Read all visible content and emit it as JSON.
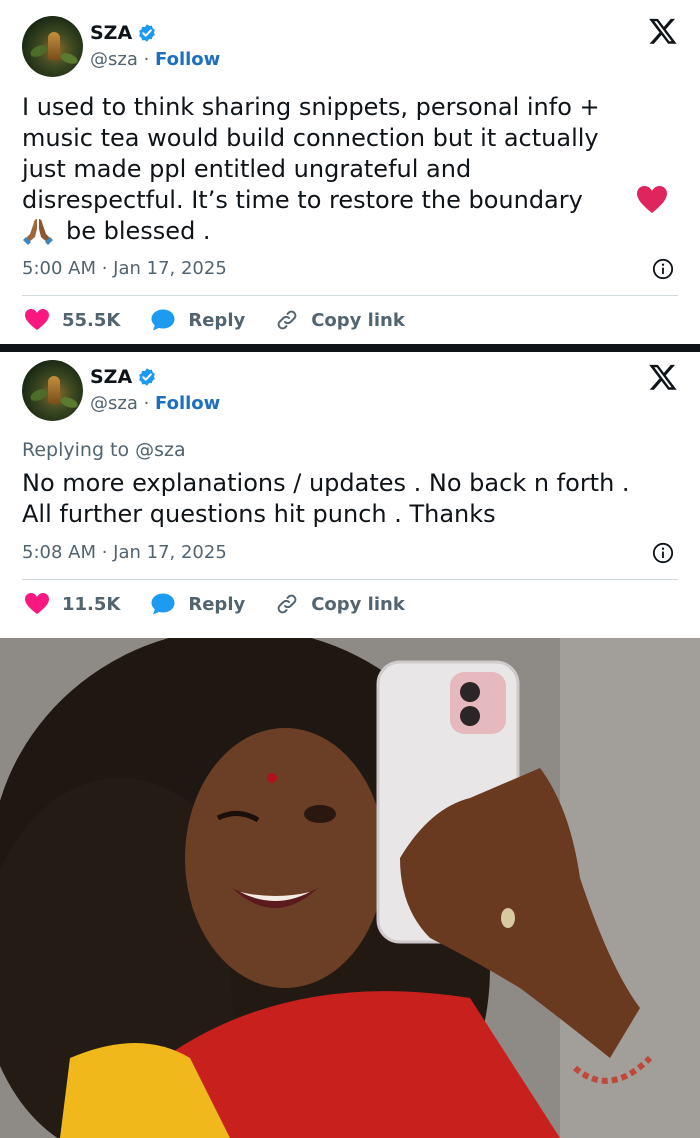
{
  "tweets": [
    {
      "name": "SZA",
      "handle": "@sza",
      "separator": " · ",
      "follow_label": "Follow",
      "replying_to": "",
      "text_lines": [
        "I used to think sharing snippets, personal info +",
        "music tea would build connection but it actually",
        "just made ppl entitled ungrateful and",
        "disrespectful. It’s time to restore the boundary"
      ],
      "text_last": "be blessed .",
      "timestamp": "5:00 AM · Jan 17, 2025",
      "likes": "55.5K",
      "reply_label": "Reply",
      "copy_label": "Copy link"
    },
    {
      "name": "SZA",
      "handle": "@sza",
      "separator": " · ",
      "follow_label": "Follow",
      "replying_to": "Replying to @sza",
      "text_lines": [
        "No more explanations / updates . No back n forth .",
        "All further questions hit punch . Thanks"
      ],
      "timestamp": "5:08 AM · Jan 17, 2025",
      "likes": "11.5K",
      "reply_label": "Reply",
      "copy_label": "Copy link"
    }
  ],
  "icons": {
    "verified": "verified-badge-icon",
    "x_logo": "x-logo-icon",
    "info": "info-icon",
    "like": "heart-icon",
    "reply": "reply-bubble-icon",
    "copy": "link-icon",
    "emoji_heart": "red-heart-emoji",
    "emoji_pray": "folded-hands-emoji"
  },
  "colors": {
    "like": "#f91880",
    "reply": "#1d9bf0",
    "follow": "#1d6fbf",
    "muted": "#536471",
    "text": "#0f1419",
    "verified": "#1d9bf0",
    "emoji_heart": "#e0245e"
  }
}
